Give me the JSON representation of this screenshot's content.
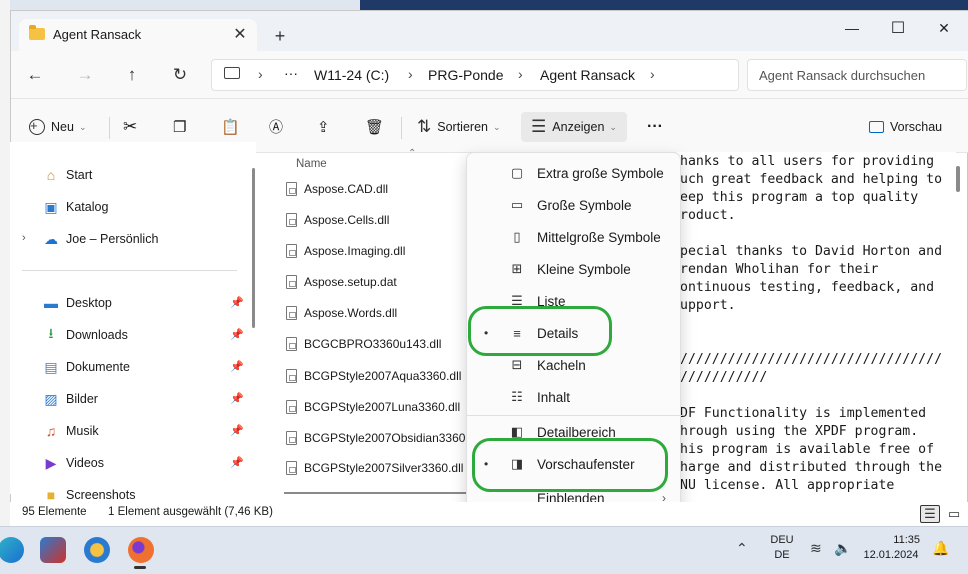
{
  "window": {
    "tab_title": "Agent Ransack",
    "close_tab": "✕",
    "new_tab": "+",
    "minimize": "—",
    "maximize": "☐",
    "close": "✕"
  },
  "nav": {
    "back": "←",
    "forward": "→",
    "up": "↑",
    "refresh": "↻",
    "breadcrumbs": [
      "W11-24 (C:)",
      "PRG-Ponde",
      "Agent Ransack"
    ],
    "more": "···",
    "search_placeholder": "Agent Ransack durchsuchen"
  },
  "toolbar": {
    "new": "Neu",
    "sort": "Sortieren",
    "view": "Anzeigen",
    "more": "···",
    "preview": "Vorschau"
  },
  "sidebar": {
    "items": [
      {
        "label": "Start",
        "icon": "home-icon"
      },
      {
        "label": "Katalog",
        "icon": "gallery-icon"
      },
      {
        "label": "Joe – Persönlich",
        "icon": "onedrive-icon"
      },
      {
        "label": "Desktop",
        "icon": "desktop-icon"
      },
      {
        "label": "Downloads",
        "icon": "downloads-icon"
      },
      {
        "label": "Dokumente",
        "icon": "documents-icon"
      },
      {
        "label": "Bilder",
        "icon": "pictures-icon"
      },
      {
        "label": "Musik",
        "icon": "music-icon"
      },
      {
        "label": "Videos",
        "icon": "videos-icon"
      },
      {
        "label": "Screenshots",
        "icon": "folder-icon"
      }
    ]
  },
  "files": {
    "column_name": "Name",
    "rows": [
      "Aspose.CAD.dll",
      "Aspose.Cells.dll",
      "Aspose.Imaging.dll",
      "Aspose.setup.dat",
      "Aspose.Words.dll",
      "BCGCBPRO3360u143.dll",
      "BCGPStyle2007Aqua3360.dll",
      "BCGPStyle2007Luna3360.dll",
      "BCGPStyle2007Obsidian3360.dll",
      "BCGPStyle2007Silver3360.dll"
    ]
  },
  "view_menu": {
    "items": [
      {
        "label": "Extra große Symbole",
        "icon": "extra-large-icons-icon",
        "selected": false
      },
      {
        "label": "Große Symbole",
        "icon": "large-icons-icon",
        "selected": false
      },
      {
        "label": "Mittelgroße Symbole",
        "icon": "medium-icons-icon",
        "selected": false
      },
      {
        "label": "Kleine Symbole",
        "icon": "small-icons-icon",
        "selected": false
      },
      {
        "label": "Liste",
        "icon": "list-icon",
        "selected": false
      },
      {
        "label": "Details",
        "icon": "details-icon",
        "selected": true
      },
      {
        "label": "Kacheln",
        "icon": "tiles-icon",
        "selected": false
      },
      {
        "label": "Inhalt",
        "icon": "content-icon",
        "selected": false
      },
      {
        "label": "Detailbereich",
        "icon": "details-pane-icon",
        "selected": false
      },
      {
        "label": "Vorschaufenster",
        "icon": "preview-pane-icon",
        "selected": true
      },
      {
        "label": "Einblenden",
        "icon": "show-icon",
        "selected": false
      }
    ]
  },
  "preview_text": [
    "hanks to all users for providing",
    "uch great feedback and helping to",
    "eep this program a top quality",
    "roduct.",
    "",
    "pecial thanks to David Horton and",
    "rendan Wholihan for their",
    "ontinuous testing, feedback, and",
    "upport.",
    "",
    "",
    "/////////////////////////////////",
    "///////////",
    "",
    "DF Functionality is implemented",
    "hrough using the XPDF program.",
    "his program is available free of",
    "harge and distributed through the",
    "NU license. All appropriate"
  ],
  "status": {
    "count": "95 Elemente",
    "selection": "1 Element ausgewählt (7,46 KB)"
  },
  "taskbar": {
    "lang_top": "DEU",
    "lang_bottom": "DE",
    "time": "11:35",
    "date": "12.01.2024"
  },
  "colors": {
    "highlight_ring": "#2eaa3c",
    "accent": "#0067c0"
  }
}
